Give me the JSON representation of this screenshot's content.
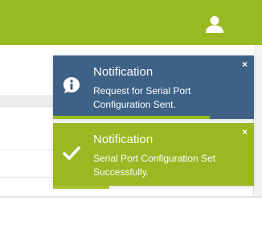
{
  "header": {
    "user_icon": "user-icon"
  },
  "colors": {
    "header_bg": "#9aba22",
    "info_bg": "#3e6186",
    "success_bg": "#99b824"
  },
  "notifications": [
    {
      "type": "info",
      "icon": "info-speech-icon",
      "title": "Notification",
      "message": "Request for Serial Port Configuration Sent.",
      "close": "×",
      "progress": 0.78
    },
    {
      "type": "success",
      "icon": "checkmark-icon",
      "title": "Notification",
      "message": "Serial Port Configuration Set Successfully.",
      "close": "×",
      "progress": 0.28
    }
  ]
}
